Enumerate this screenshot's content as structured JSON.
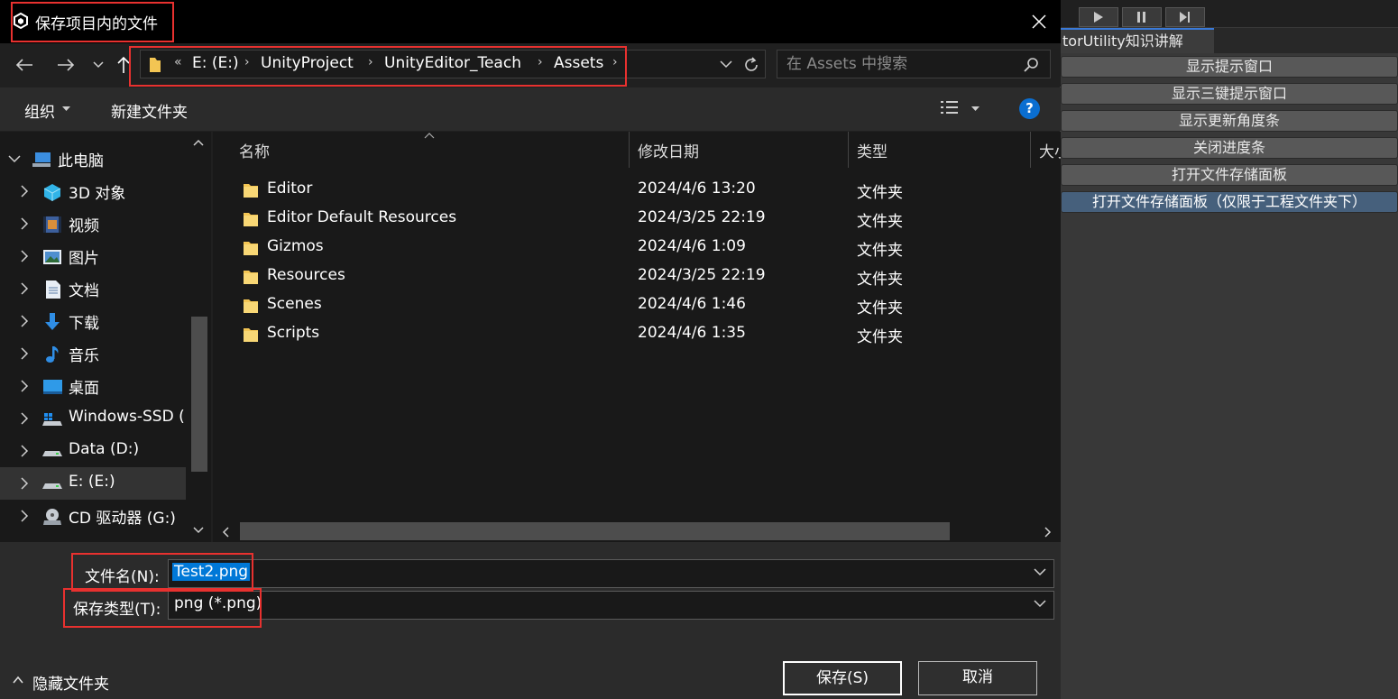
{
  "dialog": {
    "title": "保存项目内的文件",
    "breadcrumb": {
      "overflow": "«",
      "items": [
        "E: (E:)",
        "UnityProject",
        "UnityEditor_Teach",
        "Assets"
      ]
    },
    "search": {
      "placeholder": "在 Assets 中搜索"
    },
    "toolbar": {
      "organize": "组织",
      "new_folder": "新建文件夹",
      "help": "?"
    },
    "nav_tree": [
      {
        "label": "此电脑",
        "icon": "pc-icon",
        "expanded": true
      },
      {
        "label": "3D 对象",
        "icon": "3d-objects-icon"
      },
      {
        "label": "视频",
        "icon": "video-icon"
      },
      {
        "label": "图片",
        "icon": "pictures-icon"
      },
      {
        "label": "文档",
        "icon": "documents-icon"
      },
      {
        "label": "下载",
        "icon": "download-icon"
      },
      {
        "label": "音乐",
        "icon": "music-icon"
      },
      {
        "label": "桌面",
        "icon": "desktop-icon"
      },
      {
        "label": "Windows-SSD (",
        "icon": "drive-icon"
      },
      {
        "label": "Data (D:)",
        "icon": "drive-icon"
      },
      {
        "label": "E: (E:)",
        "icon": "drive-icon",
        "selected": true
      },
      {
        "label": "CD 驱动器 (G:)",
        "icon": "cd-drive-icon"
      }
    ],
    "columns": {
      "name": "名称",
      "modified": "修改日期",
      "type": "类型",
      "size": "大小"
    },
    "files": [
      {
        "name": "Editor",
        "modified": "2024/4/6 13:20",
        "type": "文件夹"
      },
      {
        "name": "Editor Default Resources",
        "modified": "2024/3/25 22:19",
        "type": "文件夹"
      },
      {
        "name": "Gizmos",
        "modified": "2024/4/6 1:09",
        "type": "文件夹"
      },
      {
        "name": "Resources",
        "modified": "2024/3/25 22:19",
        "type": "文件夹"
      },
      {
        "name": "Scenes",
        "modified": "2024/4/6 1:46",
        "type": "文件夹"
      },
      {
        "name": "Scripts",
        "modified": "2024/4/6 1:35",
        "type": "文件夹"
      }
    ],
    "filename_label": "文件名(N):",
    "filename_value": "Test2.png",
    "filetype_label": "保存类型(T):",
    "filetype_value": "png (*.png)",
    "save_label": "保存(S)",
    "cancel_label": "取消",
    "hide_folders": "隐藏文件夹"
  },
  "unity": {
    "tab_title": "torUtility知识讲解",
    "buttons": [
      "显示提示窗口",
      "显示三键提示窗口",
      "显示更新角度条",
      "关闭进度条",
      "打开文件存储面板",
      "打开文件存储面板（仅限于工程文件夹下）"
    ],
    "active_button_index": 5
  },
  "colors": {
    "highlight": "#e8312f",
    "selection": "#0078d7",
    "folder": "#f3c553",
    "help": "#0a6ed1"
  }
}
